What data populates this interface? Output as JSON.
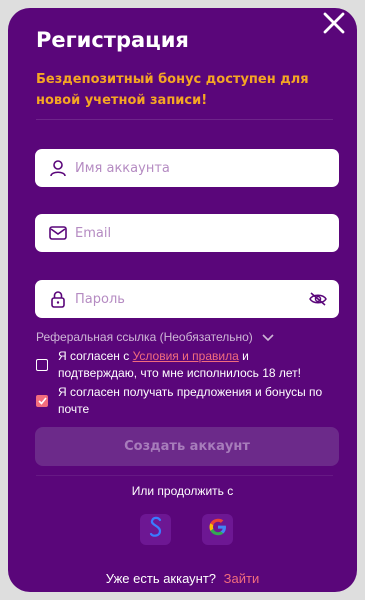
{
  "modal": {
    "title": "Регистрация",
    "bonus_text": "Бездепозитный бонус доступен для новой учетной записи!"
  },
  "fields": {
    "username_placeholder": "Имя аккаунта",
    "email_placeholder": "Email",
    "password_placeholder": "Пароль"
  },
  "referral": {
    "label": "Реферальная ссылка (Необязательно)"
  },
  "terms": {
    "prefix": "Я согласен с ",
    "link": "Условия и правила",
    "suffix": " и подтверждаю, что мне исполнилось 18 лет!",
    "checked": false
  },
  "offers": {
    "label": "Я согласен получать предложения и бонусы по почте",
    "checked": true
  },
  "submit_label": "Создать аккаунт",
  "social": {
    "label": "Или продолжить с"
  },
  "footer": {
    "question": "Уже есть аккаунт?",
    "login_link": "Зайти"
  },
  "colors": {
    "background": "#5a067a",
    "accent": "#f26d7d",
    "warning": "#f5a623"
  }
}
